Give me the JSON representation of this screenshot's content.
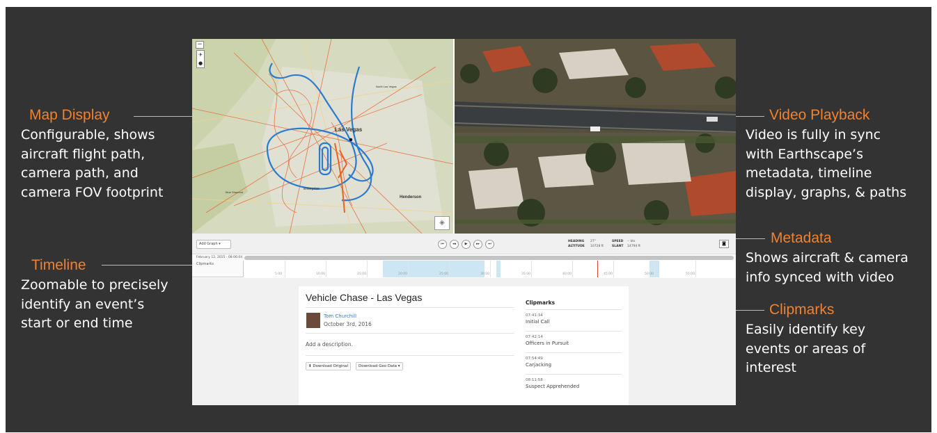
{
  "callouts": {
    "map": {
      "title": "Map Display",
      "body": "Configurable, shows\naircraft flight path,\ncamera path, and\ncamera FOV footprint"
    },
    "video": {
      "title": "Video Playback",
      "body": "Video is fully in sync\nwith Earthscape’s\nmetadata, timeline\ndisplay, graphs, & paths"
    },
    "metadata": {
      "title": "Metadata",
      "body": "Shows aircraft &  camera\ninfo synced with video"
    },
    "timeline": {
      "title": "Timeline",
      "body": "Zoomable to precisely\nidentify an event’s\nstart or end time"
    },
    "clipmarks": {
      "title": "Clipmarks",
      "body": "Easily identify key\nevents or areas of\ninterest"
    }
  },
  "map": {
    "zoom_out": "−",
    "labels": {
      "las_vegas": "Las Vegas",
      "henderson": "Henderson",
      "enterprise": "Enterprise",
      "north_las_vegas": "North Las Vegas",
      "blue_diamond": "Blue Diamond"
    }
  },
  "controls": {
    "add_graph": "Add Graph",
    "heading_label": "HEADING",
    "heading_value": "27°",
    "altitude_label": "ALTITUDE",
    "altitude_value": "10728 ft",
    "speed_label": "SPEED",
    "speed_value": "-- kts",
    "slant_label": "SLANT",
    "slant_value": "14794 ft"
  },
  "timeline": {
    "date": "February 12, 2015 - 08:06:04",
    "clipmarks_label": "Clipmarks",
    "ticks": [
      "5:00",
      "10:00",
      "15:00",
      "20:00",
      "25:00",
      "30:00",
      "35:00",
      "40:00",
      "45:00",
      "50:00",
      "55:00"
    ]
  },
  "video_card": {
    "title": "Vehicle Chase - Las Vegas",
    "author": "Tom Churchill",
    "date": "October 3rd, 2016",
    "description": "Add a description.",
    "download_original": "Download Original",
    "download_geo": "Download Geo Data ▾"
  },
  "clipmarks": {
    "heading": "Clipmarks",
    "items": [
      {
        "time": "07:41:34",
        "label": "Initial Call"
      },
      {
        "time": "07:42:14",
        "label": "Officers in Pursuit"
      },
      {
        "time": "07:54:49",
        "label": "Carjacking"
      },
      {
        "time": "08:11:58",
        "label": "Suspect Apprehended"
      }
    ]
  },
  "colors": {
    "accent": "#f08230",
    "backdrop": "#333333",
    "flight_path": "#2a7bd0",
    "camera_path": "#e8632a",
    "timeline_segment": "#cde6f3"
  }
}
